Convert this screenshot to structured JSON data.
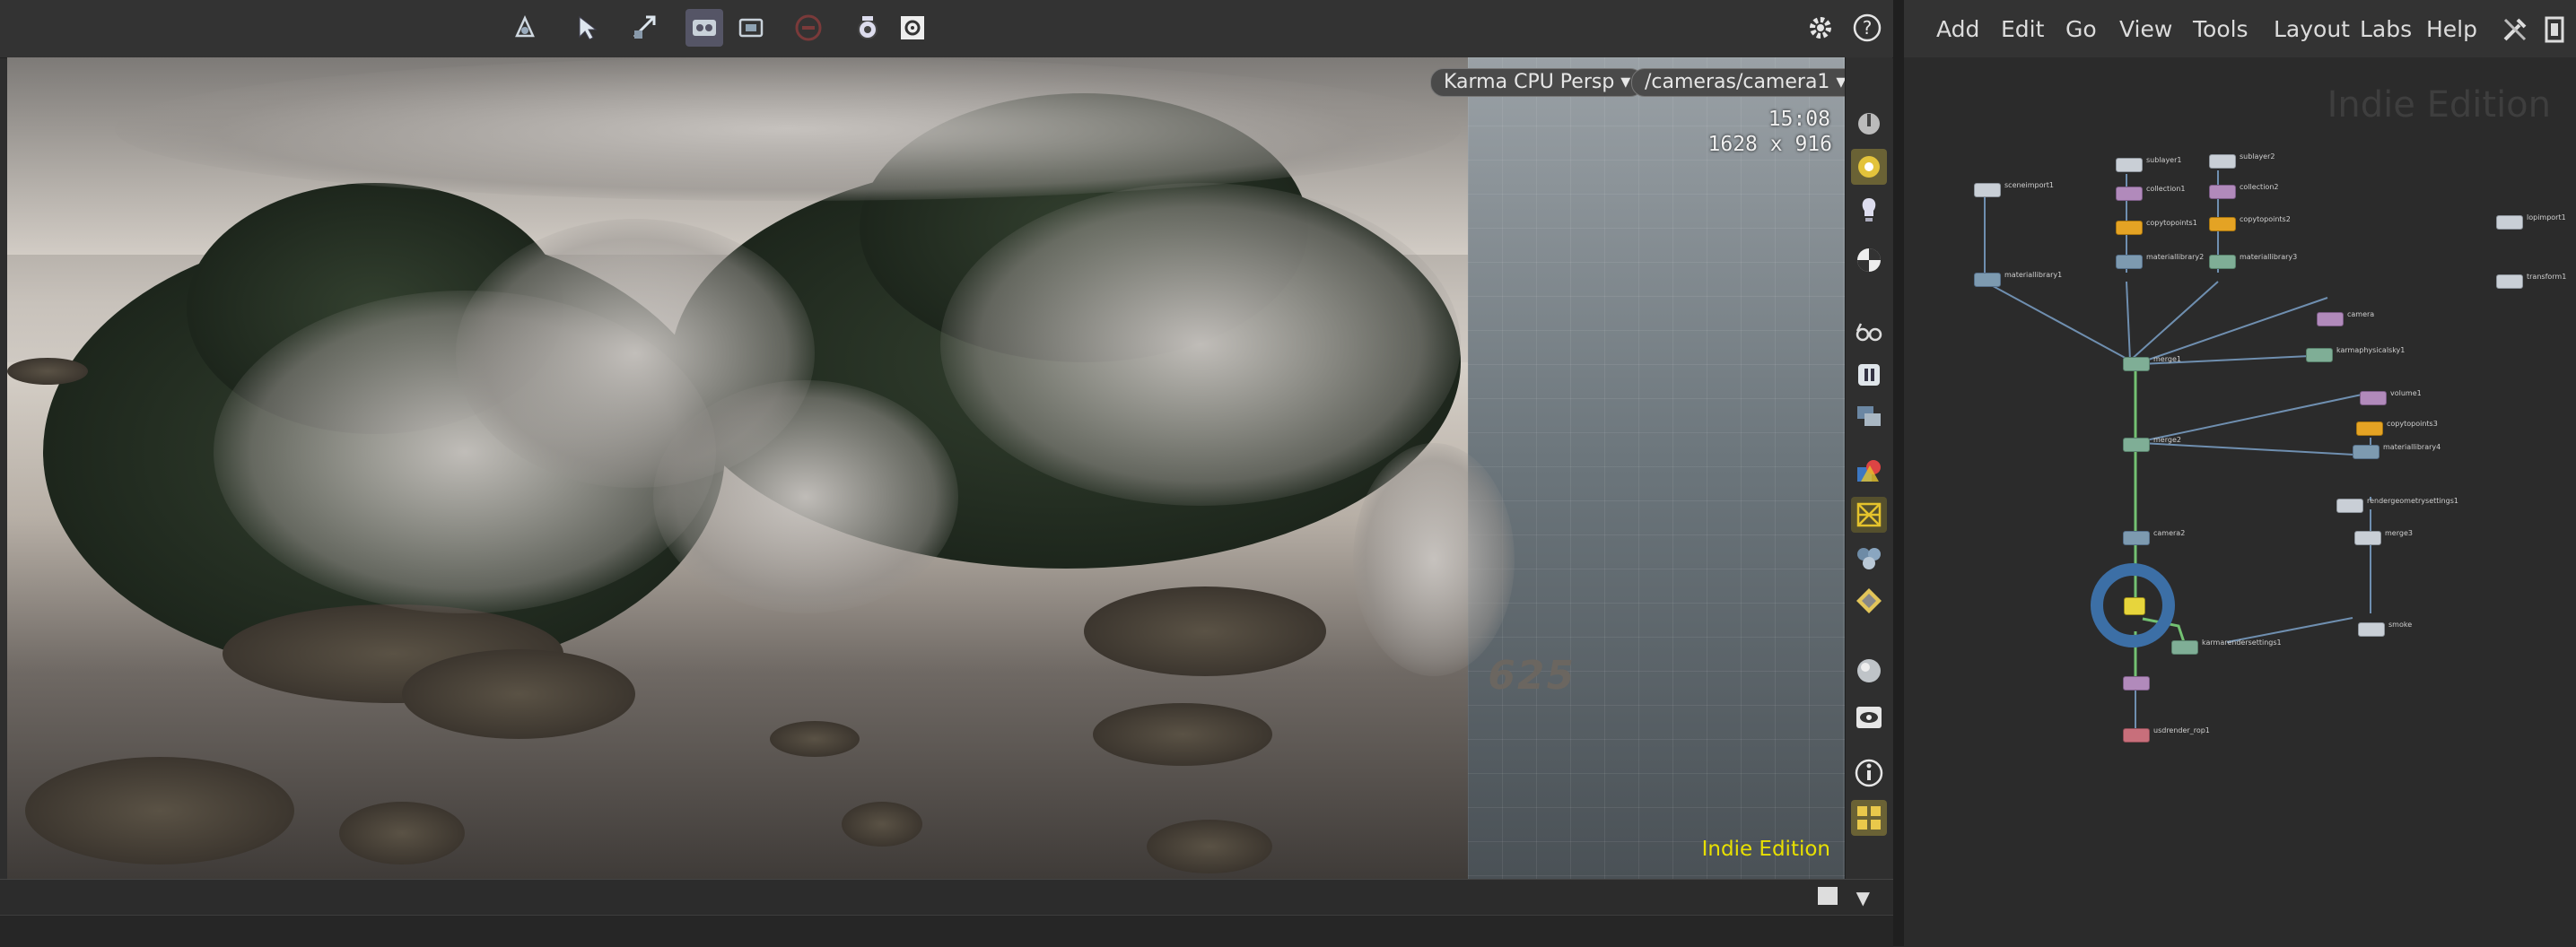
{
  "viewer": {
    "renderer": "Karma CPU  Persp",
    "camera": "/cameras/camera1",
    "time": "15:08",
    "resolution": "1628 x 916",
    "edition": "Indie Edition",
    "grid_label": "625"
  },
  "menu": {
    "items": [
      "Add",
      "Edit",
      "Go",
      "View",
      "Tools",
      "Layout",
      "Labs",
      "Help"
    ]
  },
  "network": {
    "edition": "Indie Edition",
    "nodes": {
      "sceneimport1": "sceneimport1",
      "sublayer1": "sublayer1",
      "sublayer2": "sublayer2",
      "collection1": "collection1",
      "collection2": "collection2",
      "copytopoints1": "copytopoints1",
      "copytopoints2": "copytopoints2",
      "materiallibrary1": "materiallibrary1",
      "materiallibrary2": "materiallibrary2",
      "materiallibrary3": "materiallibrary3",
      "lopimport1": "lopimport1",
      "transform1": "transform1",
      "camera": "camera",
      "karmaphysicalsky1": "karmaphysicalsky1",
      "merge1": "merge1",
      "merge2": "merge2",
      "merge3": "merge3",
      "volume1": "volume1",
      "copytopoints3": "copytopoints3",
      "materiallibrary4": "materiallibrary4",
      "rendergeometrysettings1": "rendergeometrysettings1",
      "camera2": "camera2",
      "karmarendersettings": "karmarendersettings1",
      "smoke": "smoke",
      "usdrender": "usdrender_rop1"
    }
  }
}
